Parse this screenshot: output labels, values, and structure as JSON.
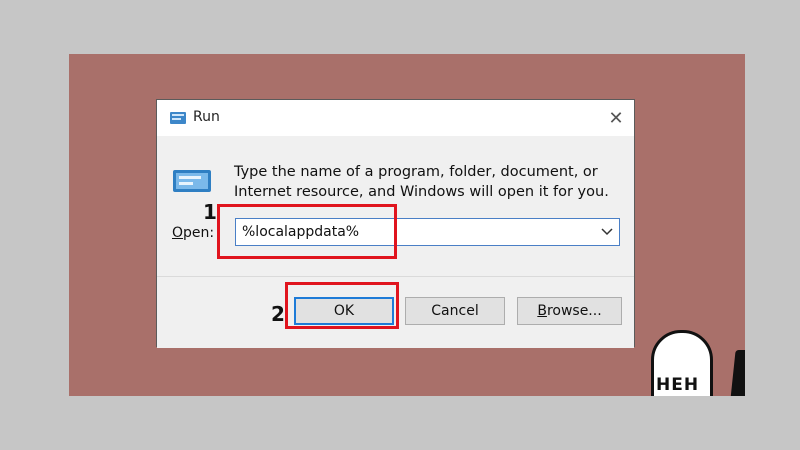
{
  "window": {
    "title": "Run",
    "close_glyph": "✕",
    "title_icon": "run-icon"
  },
  "dialog": {
    "description": "Type the name of a program, folder, document, or Internet resource, and Windows will open it for you.",
    "open_label_accel": "O",
    "open_label_rest": "pen:",
    "open_value": "%localappdata%"
  },
  "buttons": {
    "ok": "OK",
    "cancel": "Cancel",
    "browse_accel": "B",
    "browse_rest": "rowse..."
  },
  "annotations": {
    "step1": "1",
    "step2": "2",
    "highlight_color": "#e0141e"
  },
  "background": {
    "bubble_text": "HEH",
    "wallpaper_color": "#a9706a"
  }
}
